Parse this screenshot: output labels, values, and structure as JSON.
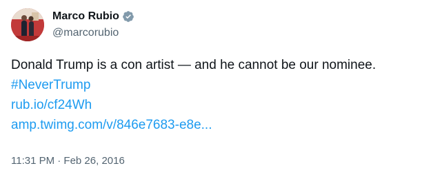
{
  "tweet": {
    "author": {
      "display_name": "Marco Rubio",
      "handle": "@marcorubio",
      "verified_icon": "verified-badge-icon",
      "badge_color": "#829aab"
    },
    "text": "Donald Trump is a con artist — and he cannot be our nominee.",
    "hashtag": "#NeverTrump",
    "links": [
      "rub.io/cf24Wh",
      "amp.twimg.com/v/846e7683-e8e..."
    ],
    "timestamp": "11:31 PM · Feb 26, 2016",
    "link_color": "#1d9bf0"
  }
}
